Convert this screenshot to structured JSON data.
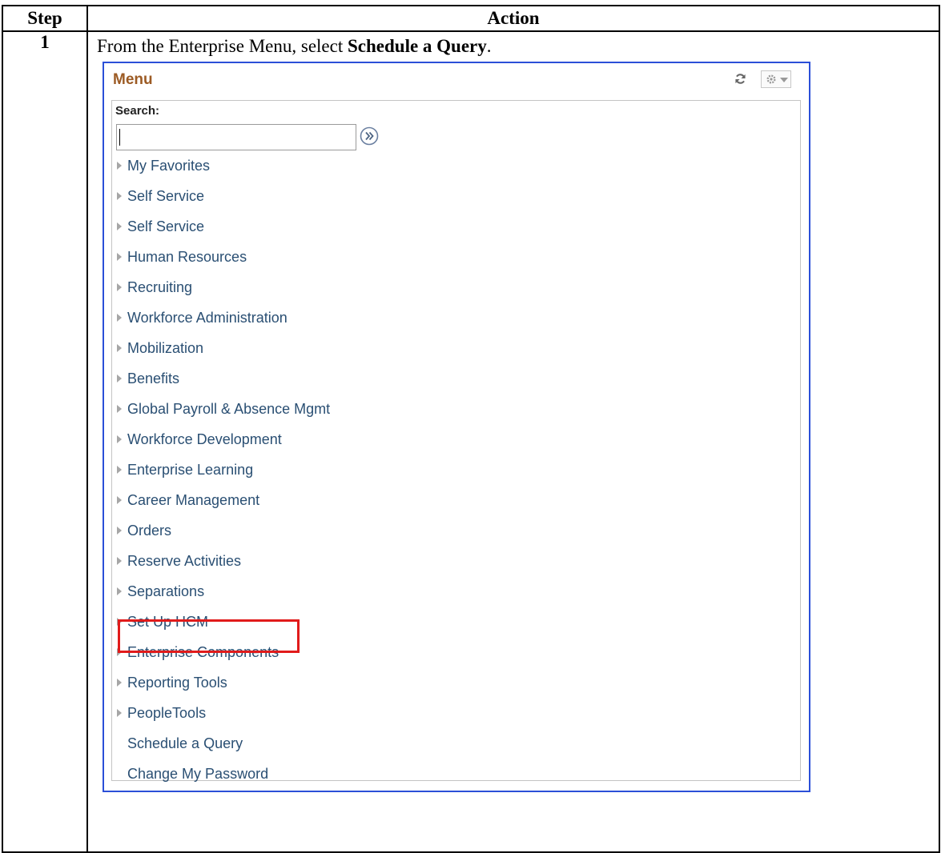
{
  "table": {
    "step_header": "Step",
    "action_header": "Action",
    "step_number": "1",
    "instruction_pre": "From the Enterprise Menu, select ",
    "instruction_bold": "Schedule a Query",
    "instruction_post": "."
  },
  "menu": {
    "title": "Menu",
    "title_color": "#9c5b24",
    "border_color": "#2b4fd8",
    "search_label": "Search:",
    "search_value": "",
    "icons": {
      "refresh": "refresh-icon",
      "settings": "gear-icon",
      "search_go": "double-chevron-right-icon",
      "expand": "triangle-right-icon"
    },
    "folders": [
      "My Favorites",
      "Self Service",
      "Self Service",
      "Human Resources",
      "Recruiting",
      "Workforce Administration",
      "Mobilization",
      "Benefits",
      "Global Payroll & Absence Mgmt",
      "Workforce Development",
      "Enterprise Learning",
      "Career Management",
      "Orders",
      "Reserve Activities",
      "Separations",
      "Set Up HCM",
      "Enterprise Components",
      "Reporting Tools",
      "PeopleTools"
    ],
    "links": [
      "Schedule a Query",
      "Change My Password"
    ],
    "highlight_color": "#e11b1b"
  }
}
